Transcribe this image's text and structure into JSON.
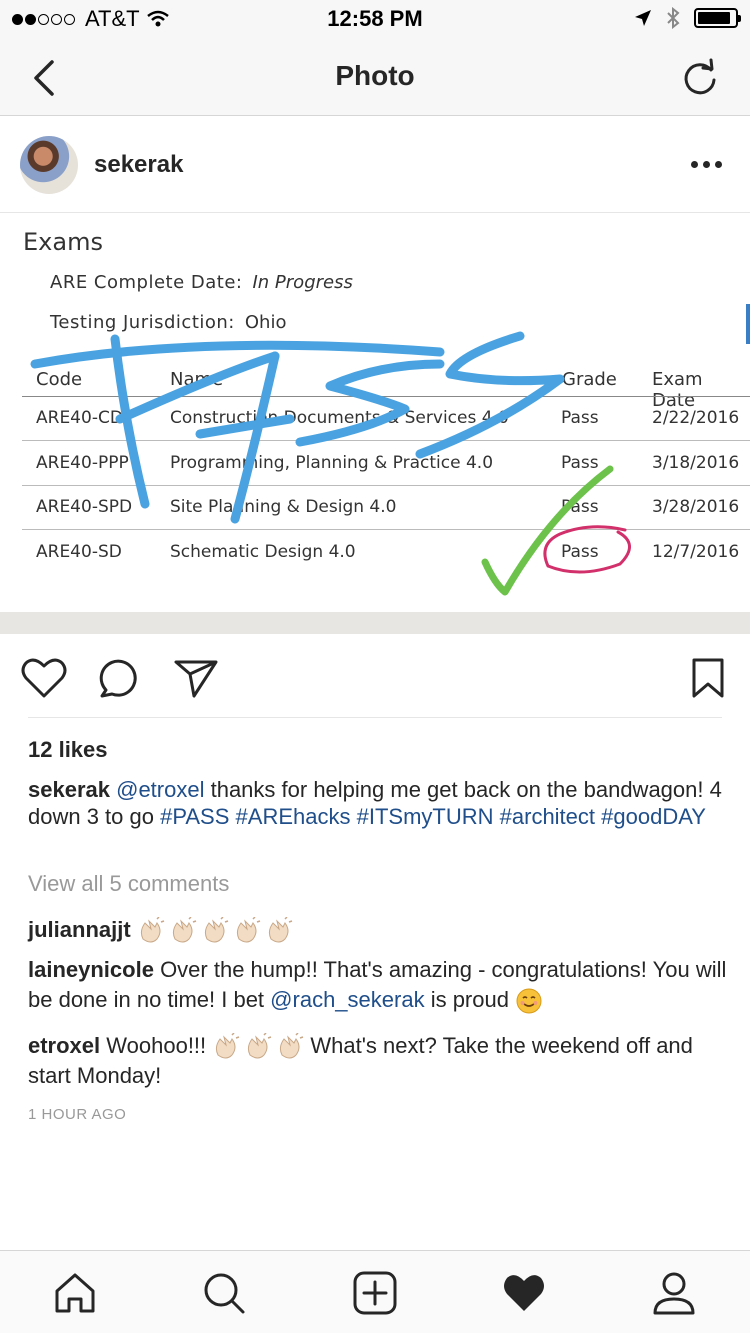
{
  "status_bar": {
    "carrier": "AT&T",
    "time": "12:58 PM",
    "signal_bars_filled": 2,
    "signal_bars_total": 5,
    "battery_level": 0.9
  },
  "nav": {
    "title": "Photo",
    "back_icon": "chevron-left-icon",
    "refresh_icon": "refresh-icon"
  },
  "post": {
    "username": "sekerak",
    "more_icon": "more-horizontal-icon"
  },
  "photo": {
    "heading": "Exams",
    "meta": [
      {
        "label": "ARE Complete Date:",
        "value": "In Progress"
      },
      {
        "label": "Testing Jurisdiction:",
        "value": "Ohio"
      }
    ],
    "columns": [
      "Code",
      "Name",
      "Grade",
      "Exam Date"
    ],
    "rows": [
      {
        "code": "ARE40-CD",
        "name": "Construction Documents & Services 4.0",
        "grade": "Pass",
        "date": "2/22/2016"
      },
      {
        "code": "ARE40-PPP",
        "name": "Programming, Planning & Practice 4.0",
        "grade": "Pass",
        "date": "3/18/2016"
      },
      {
        "code": "ARE40-SPD",
        "name": "Site Planning & Design 4.0",
        "grade": "Pass",
        "date": "3/28/2016"
      },
      {
        "code": "ARE40-SD",
        "name": "Schematic Design 4.0",
        "grade": "Pass",
        "date": "12/7/2016"
      }
    ],
    "overlay_text": "PASS",
    "overlay_color": "#4aa3e0",
    "check_color": "#6cc24a",
    "circle_color": "#d1306a"
  },
  "actions": {
    "like_icon": "heart-outline-icon",
    "comment_icon": "comment-icon",
    "share_icon": "send-icon",
    "save_icon": "bookmark-icon"
  },
  "likes": "12 likes",
  "caption": {
    "user": "sekerak",
    "mention": "@etroxel",
    "text1": " thanks for helping me get back on the bandwagon! 4 down 3 to go ",
    "hashtags": [
      "#PASS",
      "#AREhacks",
      "#ITSmyTURN",
      "#architect",
      "#goodDAY"
    ]
  },
  "view_all": "View all 5 comments",
  "comments": [
    {
      "user": "juliannajjt",
      "text": "",
      "claps": 5
    },
    {
      "user": "laineynicole",
      "text_before": " Over the hump!! That's amazing - congratulations! You will be done in no time!  I bet ",
      "mention": "@rach_sekerak",
      "text_after": " is proud "
    },
    {
      "user": "etroxel",
      "text_before": " Woohoo!!! ",
      "claps": 3,
      "text_after": "  What's next? Take the weekend off and start Monday!"
    }
  ],
  "timestamp": "1 HOUR AGO",
  "tab_bar": {
    "icons": [
      "home-icon",
      "search-icon",
      "add-post-icon",
      "heart-filled-icon",
      "profile-icon"
    ]
  }
}
